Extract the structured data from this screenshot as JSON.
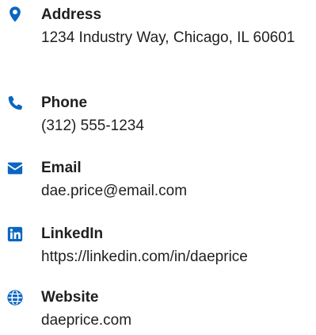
{
  "contact": {
    "accent_color": "#0a66c2",
    "items": [
      {
        "icon": "map-pin-icon",
        "label": "Address",
        "value": "1234 Industry Way, Chicago, IL 60601"
      },
      {
        "icon": "phone-icon",
        "label": "Phone",
        "value": "(312) 555-1234"
      },
      {
        "icon": "envelope-icon",
        "label": "Email",
        "value": "dae.price@email.com"
      },
      {
        "icon": "linkedin-icon",
        "label": "LinkedIn",
        "value": "https://linkedin.com/in/daeprice"
      },
      {
        "icon": "globe-icon",
        "label": "Website",
        "value": "daeprice.com"
      }
    ]
  }
}
